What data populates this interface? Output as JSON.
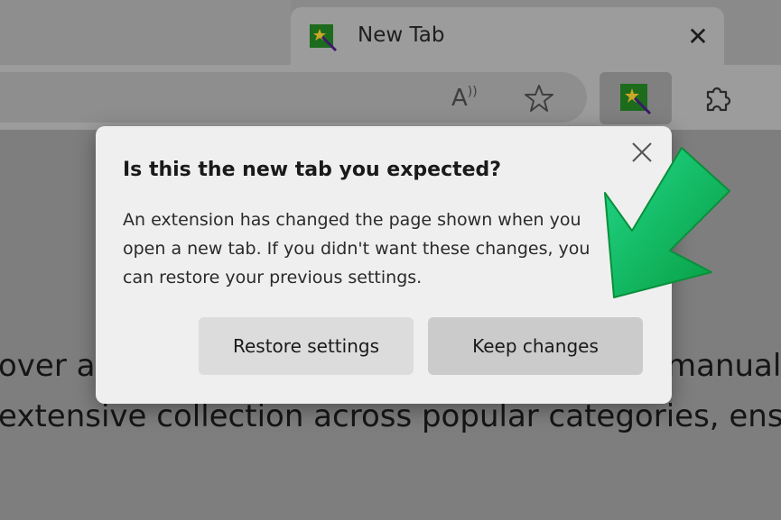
{
  "tab": {
    "title": "New Tab",
    "close_glyph": "✕"
  },
  "toolbar": {
    "read_aloud_glyph": "A⁾",
    "icons": [
      "read-aloud-icon",
      "favorite-star-icon",
      "extension-wand-icon",
      "extensions-puzzle-icon"
    ]
  },
  "popup": {
    "title": "Is this the new tab you expected?",
    "body": "An extension has changed the page shown when you open a new tab. If you didn't want these changes, you can restore your previous settings.",
    "restore_label": "Restore settings",
    "keep_label": "Keep changes"
  },
  "background_text": {
    "line1_left": "over a",
    "line1_right": "manual",
    "line2": "extensive collection across popular categories, ens"
  },
  "colors": {
    "arrow": "#10c060",
    "popup_bg": "#efefef"
  }
}
